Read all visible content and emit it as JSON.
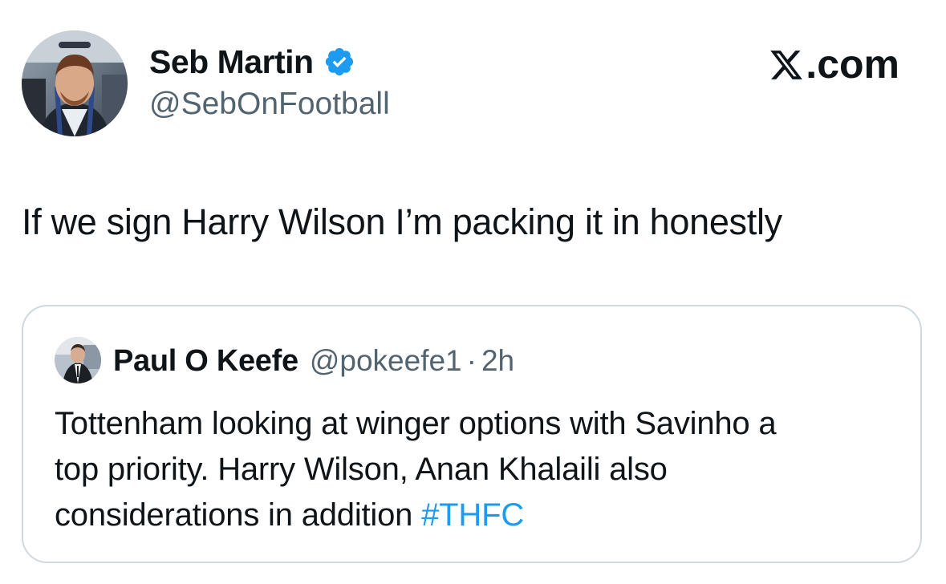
{
  "author": {
    "name": "Seb Martin",
    "handle": "@SebOnFootball",
    "verified_icon": "verified-badge-icon",
    "avatar_icon": "user-avatar"
  },
  "site": {
    "logo_text": ".com",
    "logo_icon": "x-logo-icon"
  },
  "tweet": {
    "text": "If we sign Harry Wilson I’m packing it in honestly"
  },
  "quoted_tweet": {
    "name": "Paul O Keefe",
    "handle": "@pokeefe1",
    "separator": "·",
    "time": "2h",
    "text_line1": "Tottenham looking at winger options with Savinho a",
    "text_line2": "top priority. Harry Wilson, Anan Khalaili also",
    "text_line3": "considerations in addition ",
    "hashtag": "#THFC"
  },
  "colors": {
    "text_primary": "#0f1419",
    "text_secondary": "#536471",
    "accent": "#1d9bf0",
    "border": "#cfd9de"
  }
}
